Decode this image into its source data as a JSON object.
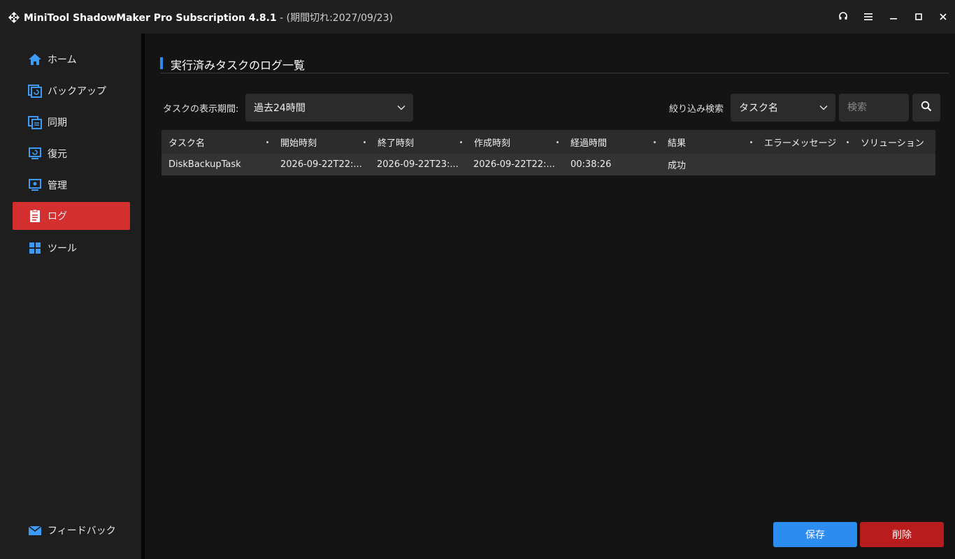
{
  "titlebar": {
    "app_name": "MiniTool ShadowMaker Pro Subscription 4.8.1",
    "subtitle": " - (期間切れ:2027/09/23)",
    "controls": [
      "headset-icon",
      "menu-icon",
      "minimize-icon",
      "maximize-icon",
      "close-icon"
    ]
  },
  "sidebar": {
    "items": [
      {
        "label": "ホーム",
        "icon": "home-icon"
      },
      {
        "label": "バックアップ",
        "icon": "backup-icon"
      },
      {
        "label": "同期",
        "icon": "sync-icon"
      },
      {
        "label": "復元",
        "icon": "restore-icon"
      },
      {
        "label": "管理",
        "icon": "manage-icon"
      },
      {
        "label": "ログ",
        "icon": "log-icon",
        "active": true
      },
      {
        "label": "ツール",
        "icon": "tools-icon"
      }
    ],
    "feedback": {
      "label": "フィードバック",
      "icon": "mail-icon"
    }
  },
  "main": {
    "title": "実行済みタスクのログ一覧",
    "period_label": "タスクの表示期間:",
    "period_value": "過去24時間",
    "filter_label": "絞り込み検索",
    "filter_value": "タスク名",
    "search_placeholder": "検索",
    "table": {
      "columns": [
        "タスク名",
        "開始時刻",
        "終了時刻",
        "作成時刻",
        "経過時間",
        "結果",
        "エラーメッセージ",
        "ソリューション"
      ],
      "rows": [
        [
          "DiskBackupTask",
          "2026-09-22T22:...",
          "2026-09-22T23:...",
          "2026-09-22T22:...",
          "00:38:26",
          "成功",
          "",
          ""
        ]
      ]
    },
    "buttons": {
      "save": "保存",
      "delete": "削除"
    }
  },
  "colors": {
    "accent_blue": "#2d8cf0",
    "active_red": "#d32f2f",
    "delete_red": "#b81c1c"
  }
}
